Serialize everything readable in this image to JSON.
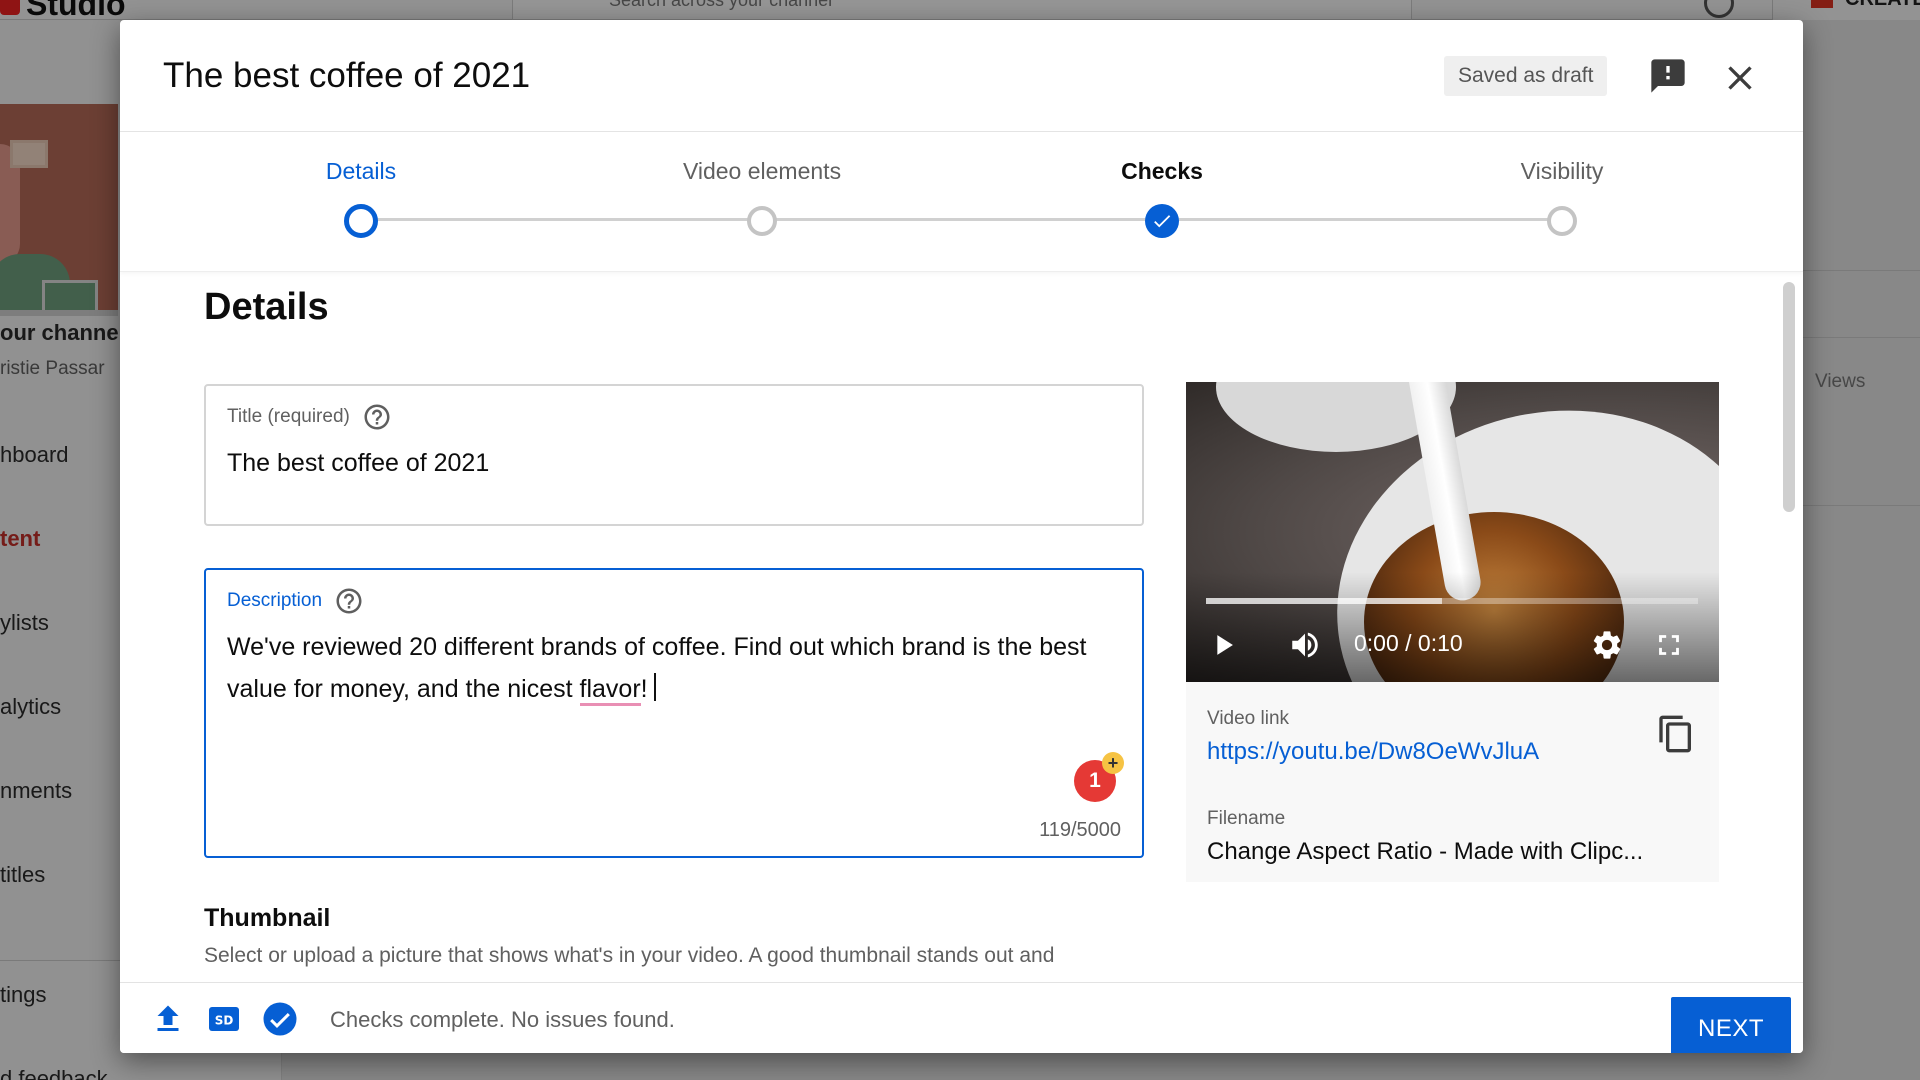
{
  "background": {
    "logo": "Studio",
    "search_placeholder": "Search across your channel",
    "create_label": "CREATE",
    "channel_title": "our channe",
    "channel_name": "ristie Passar",
    "nav": [
      "hboard",
      "tent",
      "ylists",
      "alytics",
      "nments",
      "titles",
      "tings",
      "d feedback"
    ],
    "right_col_header": "Views"
  },
  "dialog": {
    "title": "The best coffee of 2021",
    "saved_status": "Saved as draft"
  },
  "stepper": {
    "steps": [
      {
        "label": "Details",
        "state": "current"
      },
      {
        "label": "Video elements",
        "state": "todo"
      },
      {
        "label": "Checks",
        "state": "done"
      },
      {
        "label": "Visibility",
        "state": "todo"
      }
    ]
  },
  "details": {
    "heading": "Details",
    "title_field": {
      "label": "Title (required)",
      "value": "The best coffee of 2021"
    },
    "description_field": {
      "label": "Description",
      "value_part1": "We've reviewed 20 different brands of coffee. Find out which brand is the best value for money, and the nicest ",
      "value_misspelled": "flavor",
      "value_part2": "!",
      "badge_count": "1",
      "counter": "119/5000"
    },
    "thumbnail": {
      "heading": "Thumbnail",
      "description": "Select or upload a picture that shows what's in your video. A good thumbnail stands out and"
    }
  },
  "video": {
    "time": "0:00 / 0:10",
    "progress_buffered": 0.48,
    "link_label": "Video link",
    "link": "https://youtu.be/Dw8OeWvJluA",
    "filename_label": "Filename",
    "filename": "Change Aspect Ratio - Made with Clipc..."
  },
  "footer": {
    "status": "Checks complete. No issues found.",
    "next_label": "NEXT"
  },
  "colors": {
    "accent": "#065fd4",
    "badge": "#e53935"
  }
}
